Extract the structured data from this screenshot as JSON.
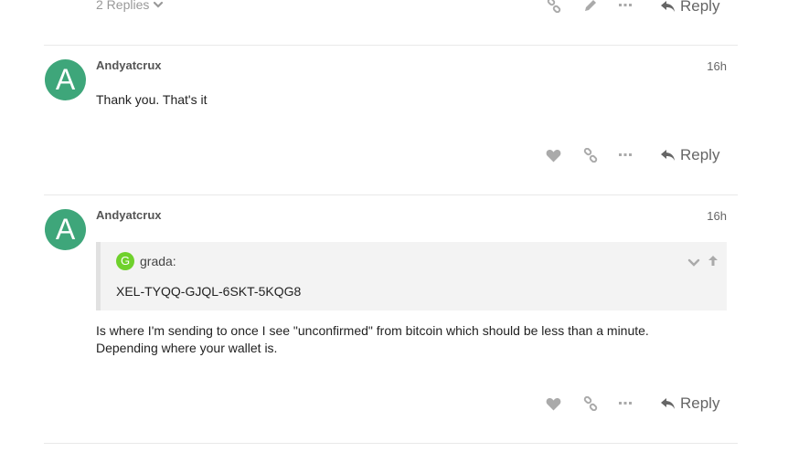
{
  "top_post": {
    "replies_label": "2 Replies",
    "reply_label": "Reply"
  },
  "posts": [
    {
      "username": "Andyatcrux",
      "avatar_letter": "A",
      "avatar_color": "#3ea67a",
      "time": "16h",
      "body": "Thank you. That's it",
      "reply_label": "Reply"
    },
    {
      "username": "Andyatcrux",
      "avatar_letter": "A",
      "avatar_color": "#3ea67a",
      "time": "16h",
      "quote": {
        "avatar_letter": "G",
        "avatar_color": "#6fd12c",
        "username": "grada:",
        "text": "XEL-TYQQ-GJQL-6SKT-5KQG8"
      },
      "body_line1": "Is where I'm sending to once I see \"unconfirmed\" from bitcoin which should be less than a minute.",
      "body_line2": "Depending where your wallet is.",
      "reply_label": "Reply"
    }
  ],
  "icons": {
    "like": "heart-icon",
    "share": "link-icon",
    "more": "ellipsis-icon",
    "edit": "pencil-icon",
    "reply": "reply-arrow-icon",
    "expand": "chevron-down-icon",
    "jump": "arrow-up-icon"
  },
  "colors": {
    "icon_gray": "#aaaaaa",
    "text_gray": "#666666",
    "divider": "#e9e9e9"
  }
}
